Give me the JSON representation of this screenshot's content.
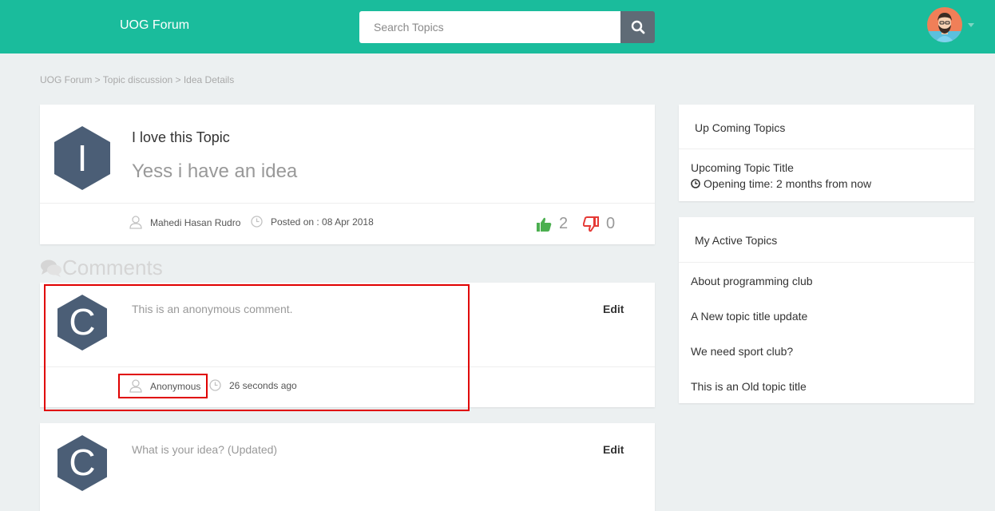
{
  "header": {
    "brand": "UOG Forum",
    "search_placeholder": "Search Topics"
  },
  "breadcrumb": "UOG Forum > Topic discussion > Idea Details",
  "topic": {
    "avatar_letter": "I",
    "title": "I love this Topic",
    "body": "Yess i have an idea",
    "author": "Mahedi Hasan Rudro",
    "posted": "Posted on : 08 Apr 2018",
    "likes": "2",
    "dislikes": "0"
  },
  "comments_heading": "Comments",
  "comments": [
    {
      "avatar_letter": "C",
      "text": "This is an anonymous comment.",
      "edit_label": "Edit",
      "author": "Anonymous",
      "time": "26 seconds ago"
    },
    {
      "avatar_letter": "C",
      "text": "What is your idea? (Updated)",
      "edit_label": "Edit"
    }
  ],
  "sidebar": {
    "upcoming": {
      "heading": "Up Coming Topics",
      "item_title": "Upcoming Topic Title",
      "item_time": "Opening time: 2 months from now"
    },
    "active": {
      "heading": "My Active Topics",
      "items": [
        "About programming club",
        "A New topic title update",
        "We need sport club?",
        "This is an Old topic title"
      ]
    }
  },
  "colors": {
    "header": "#1abc9c",
    "hex_avatar": "#4b5e76",
    "highlight": "#e00000",
    "like": "#4caf50",
    "dislike": "#e53935"
  },
  "icons": [
    "search-icon",
    "user-avatar",
    "chevron-down-icon",
    "user-icon",
    "clock-icon",
    "thumbs-up-icon",
    "thumbs-down-icon",
    "comments-icon"
  ]
}
